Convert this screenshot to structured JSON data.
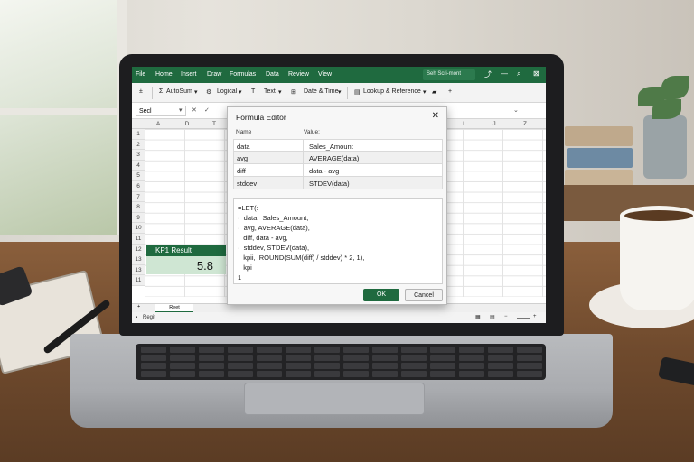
{
  "menubar": {
    "items": [
      "File",
      "Home",
      "Insert",
      "Draw",
      "Formulas",
      "Data",
      "Review",
      "View"
    ],
    "search": "Seh Scri-mont"
  },
  "ribbon": {
    "autosum": "AutoSum",
    "logical": "Logical",
    "text": "Text",
    "datetime": "Date & Time",
    "lookup": "Lookup & Reference"
  },
  "formula_bar": {
    "namebox": "Secl"
  },
  "columns": [
    "A",
    "D",
    "T",
    "I",
    "J",
    "Z"
  ],
  "rows": [
    "1",
    "2",
    "3",
    "4",
    "5",
    "6",
    "7",
    "8",
    "9",
    "10",
    "11",
    "12",
    "13",
    "13",
    "11"
  ],
  "kpi": {
    "label": "KP1 Result",
    "value": "5.8"
  },
  "sheet_tab": "Reet",
  "status": "Regit",
  "dialog": {
    "title": "Formula Editor",
    "col_name": "Name",
    "col_value": "Value:",
    "rows": [
      {
        "name": "data",
        "value": "Sales_Amount"
      },
      {
        "name": "avg",
        "value": "AVERAGE(data)"
      },
      {
        "name": "diff",
        "value": "data - avg"
      },
      {
        "name": "stddev",
        "value": "STDEV(data)"
      }
    ],
    "code": [
      "=LET(:",
      "·  data,  Sales_Amount,",
      "·  avg, AVERAGE(data),",
      "   diff, data - avg,",
      "·  stddev, STDEV(data),",
      "   kpii,  ROUND(SUM(diff) / stddev) * 2, 1),",
      "   kpi",
      "1"
    ],
    "ok": "OK",
    "cancel": "Cancel"
  }
}
